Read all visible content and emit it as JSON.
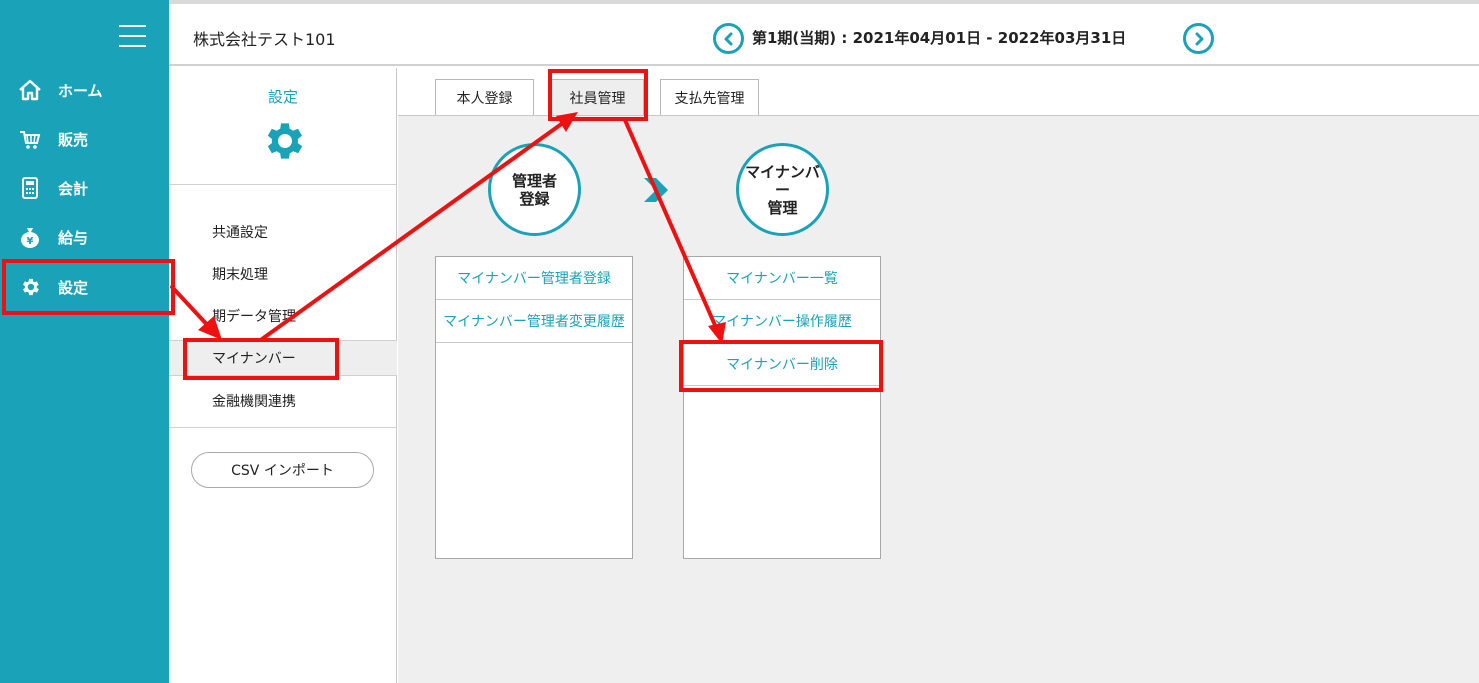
{
  "company_name": "株式会社テスト101",
  "period": {
    "label": "第1期(当期) : 2021年04月01日 - 2022年03月31日",
    "prev_icon": "chevron-left-icon",
    "next_icon": "chevron-right-icon"
  },
  "sidebar": {
    "menu_icon": "hamburger-menu-icon",
    "items": [
      {
        "label": "ホーム",
        "icon": "home-icon"
      },
      {
        "label": "販売",
        "icon": "cart-icon"
      },
      {
        "label": "会計",
        "icon": "calculator-icon"
      },
      {
        "label": "給与",
        "icon": "money-bag-icon"
      },
      {
        "label": "設定",
        "icon": "gear-icon"
      }
    ]
  },
  "settings_panel": {
    "title": "設定",
    "icon": "gear-icon",
    "menu": [
      "共通設定",
      "期末処理",
      "期データ管理",
      "マイナンバー",
      "金融機関連携"
    ],
    "active_index": 3,
    "csv_button": "CSV インポート"
  },
  "tabs": {
    "items": [
      "本人登録",
      "社員管理",
      "支払先管理"
    ],
    "active_index": 1
  },
  "columns": [
    {
      "circle_label_lines": [
        "管理者",
        "登録"
      ],
      "items": [
        "マイナンバー管理者登録",
        "マイナンバー管理者変更履歴"
      ]
    },
    {
      "circle_label_lines": [
        "マイナンバー",
        "管理"
      ],
      "items": [
        "マイナンバー一覧",
        "マイナンバー操作履歴",
        "マイナンバー削除"
      ]
    }
  ],
  "colors": {
    "accent": "#1aa2b8",
    "highlight": "#ee1111",
    "sidebar_bg": "#1aa2b8",
    "content_bg": "#efefef"
  }
}
